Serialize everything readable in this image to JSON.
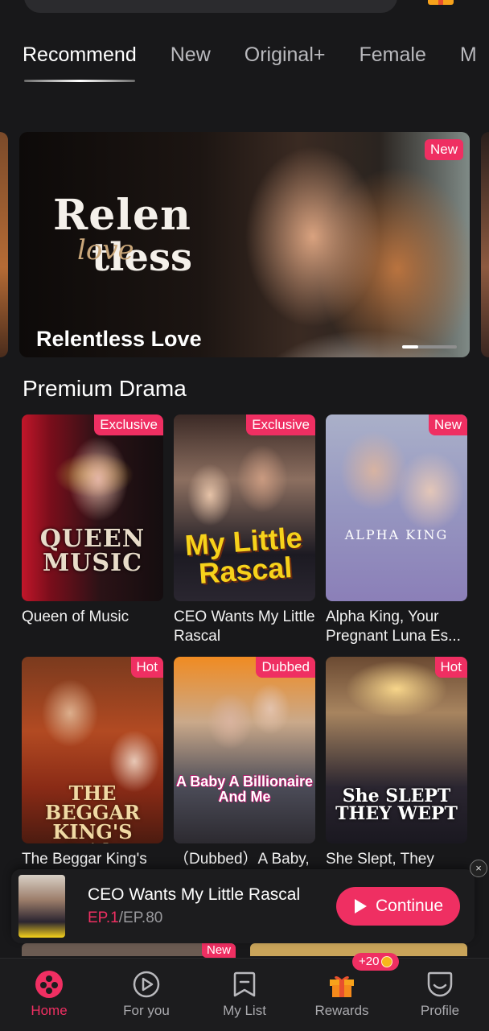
{
  "tabs": [
    {
      "label": "Recommend",
      "active": true
    },
    {
      "label": "New",
      "active": false
    },
    {
      "label": "Original+",
      "active": false
    },
    {
      "label": "Female",
      "active": false
    },
    {
      "label": "M",
      "active": false
    }
  ],
  "banner": {
    "art_title_line1": "Relen",
    "art_title_line2": "tless",
    "art_title_script": "love",
    "caption": "Relentless Love",
    "badge": "New"
  },
  "premium": {
    "title": "Premium Drama",
    "cards": [
      {
        "title": "Queen of Music",
        "badge": "Exclusive",
        "poster_text": "QUEEN MUSIC"
      },
      {
        "title": "CEO Wants My Little Rascal",
        "badge": "Exclusive",
        "poster_text": "My Little Rascal"
      },
      {
        "title": "Alpha King, Your Pregnant Luna Es...",
        "badge": "New",
        "poster_text": "ALPHA KING"
      },
      {
        "title": "The Beggar King's",
        "badge": "Hot",
        "poster_text": "THE BEGGAR KING'S Bride"
      },
      {
        "title": "（Dubbed）A Baby,",
        "badge": "Dubbed",
        "poster_text": "A Baby A Billionaire And Me"
      },
      {
        "title": "She Slept, They",
        "badge": "Hot",
        "poster_text": "She SLEPT THEY WEPT"
      }
    ]
  },
  "next_row_badge": "New",
  "continue": {
    "title": "CEO Wants My Little Rascal",
    "episode_current": "EP.1",
    "episode_total": "/EP.80",
    "button": "Continue",
    "close": "×"
  },
  "nav": {
    "home": "Home",
    "for_you": "For you",
    "my_list": "My List",
    "rewards": "Rewards",
    "profile": "Profile",
    "reward_badge": "+20"
  },
  "colors": {
    "accent": "#ef2f62",
    "background": "#18181a"
  }
}
